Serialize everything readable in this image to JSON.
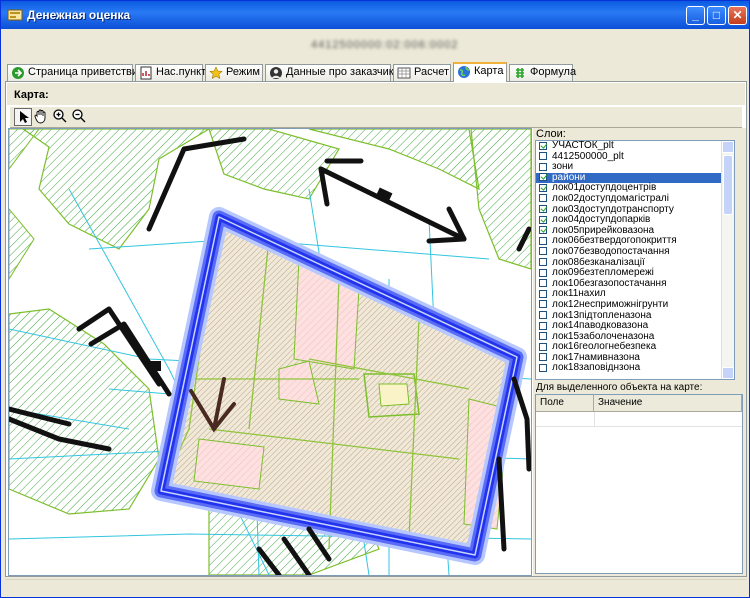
{
  "window": {
    "title": "Денежная оценка",
    "header_code": "4412500000:02:006:0002",
    "controls": {
      "minimize": "_",
      "maximize": "□",
      "close": "✕"
    }
  },
  "tabs": [
    {
      "label": "Страница приветствия",
      "icon": "green-arrow-icon"
    },
    {
      "label": "Нас.пункт",
      "icon": "document-chart-icon"
    },
    {
      "label": "Режим",
      "icon": "star-icon"
    },
    {
      "label": "Данные про заказчика",
      "icon": "person-icon"
    },
    {
      "label": "Расчет",
      "icon": "grid-icon"
    },
    {
      "label": "Карта",
      "icon": "globe-icon",
      "active": true
    },
    {
      "label": "Формула",
      "icon": "formula-icon"
    }
  ],
  "map_panel": {
    "label": "Карта:",
    "tools": [
      "pointer-icon",
      "pan-hand-icon",
      "zoom-in-icon",
      "zoom-out-icon"
    ]
  },
  "layers": {
    "label": "Слои:",
    "items": [
      {
        "name": "УЧАСТОК_plt",
        "checked": true
      },
      {
        "name": "4412500000_plt",
        "checked": false
      },
      {
        "name": "зони",
        "checked": false
      },
      {
        "name": "райони",
        "checked": true,
        "selected": true
      },
      {
        "name": "лок01доступдоцентрів",
        "checked": true
      },
      {
        "name": "лок02доступдомагістралі",
        "checked": false
      },
      {
        "name": "лок03доступдотранспорту",
        "checked": true
      },
      {
        "name": "лок04доступдопарків",
        "checked": true
      },
      {
        "name": "лок05прирейковазона",
        "checked": true
      },
      {
        "name": "лок06безтвердогопокриття",
        "checked": false
      },
      {
        "name": "лок07безводопостачання",
        "checked": false
      },
      {
        "name": "лок08безканалізації",
        "checked": false
      },
      {
        "name": "лок09безтепломережі",
        "checked": false
      },
      {
        "name": "лок10безгазопостачання",
        "checked": false
      },
      {
        "name": "лок11нахил",
        "checked": false
      },
      {
        "name": "лок12несприможнігрунти",
        "checked": false
      },
      {
        "name": "лок13підтопленазона",
        "checked": false
      },
      {
        "name": "лок14паводковазона",
        "checked": false
      },
      {
        "name": "лок15заболоченазона",
        "checked": false
      },
      {
        "name": "лок16геологнебезпека",
        "checked": false
      },
      {
        "name": "лок17намивназона",
        "checked": false
      },
      {
        "name": "лок18заповіднзона",
        "checked": false
      }
    ]
  },
  "properties": {
    "label": "Для выделенного объекта на карте:",
    "columns": [
      "Поле",
      "Значение"
    ]
  },
  "colors": {
    "accent": "#316ac5",
    "parcel_outline": "#2233ee",
    "hatch_green": "#3fa53f",
    "road_black": "#111111",
    "grid_cyan": "#33c5e0"
  }
}
